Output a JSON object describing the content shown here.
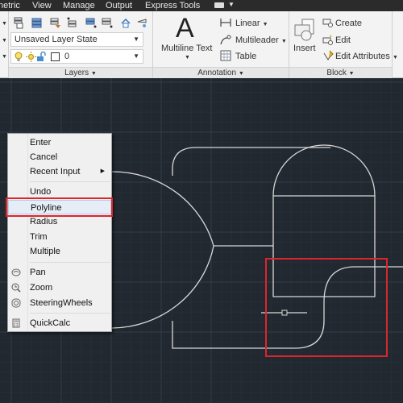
{
  "menu_tabs": [
    "netric",
    "View",
    "Manage",
    "Output",
    "Express Tools"
  ],
  "layers": {
    "layer_state": "Unsaved Layer State",
    "current_layer": "0",
    "panel_label": "Layers"
  },
  "annotation": {
    "multiline_text": "Multiline Text",
    "letter": "A",
    "linear": "Linear",
    "multileader": "Multileader",
    "table": "Table",
    "panel_label": "Annotation"
  },
  "block": {
    "insert": "Insert",
    "create": "Create",
    "edit": "Edit",
    "edit_attributes": "Edit Attributes",
    "panel_label": "Block"
  },
  "context_menu": {
    "items": [
      {
        "label": "Enter"
      },
      {
        "label": "Cancel"
      },
      {
        "label": "Recent Input",
        "submenu": true
      },
      {
        "label": "Undo"
      },
      {
        "label": "Polyline",
        "highlighted": true
      },
      {
        "label": "Radius"
      },
      {
        "label": "Trim"
      },
      {
        "label": "Multiple"
      },
      {
        "label": "Pan",
        "icon": "pan-hand-icon"
      },
      {
        "label": "Zoom",
        "icon": "zoom-icon"
      },
      {
        "label": "SteeringWheels",
        "icon": "steeringwheels-icon"
      },
      {
        "label": "QuickCalc",
        "icon": "calculator-icon"
      }
    ]
  },
  "colors": {
    "canvas_bg": "#212830",
    "grid": "#2c3440",
    "geometry": "#d8d8d8",
    "highlight_red": "#e0242b",
    "ribbon_bg": "#f3f3f3",
    "tabbar_bg": "#2b2b2b"
  }
}
